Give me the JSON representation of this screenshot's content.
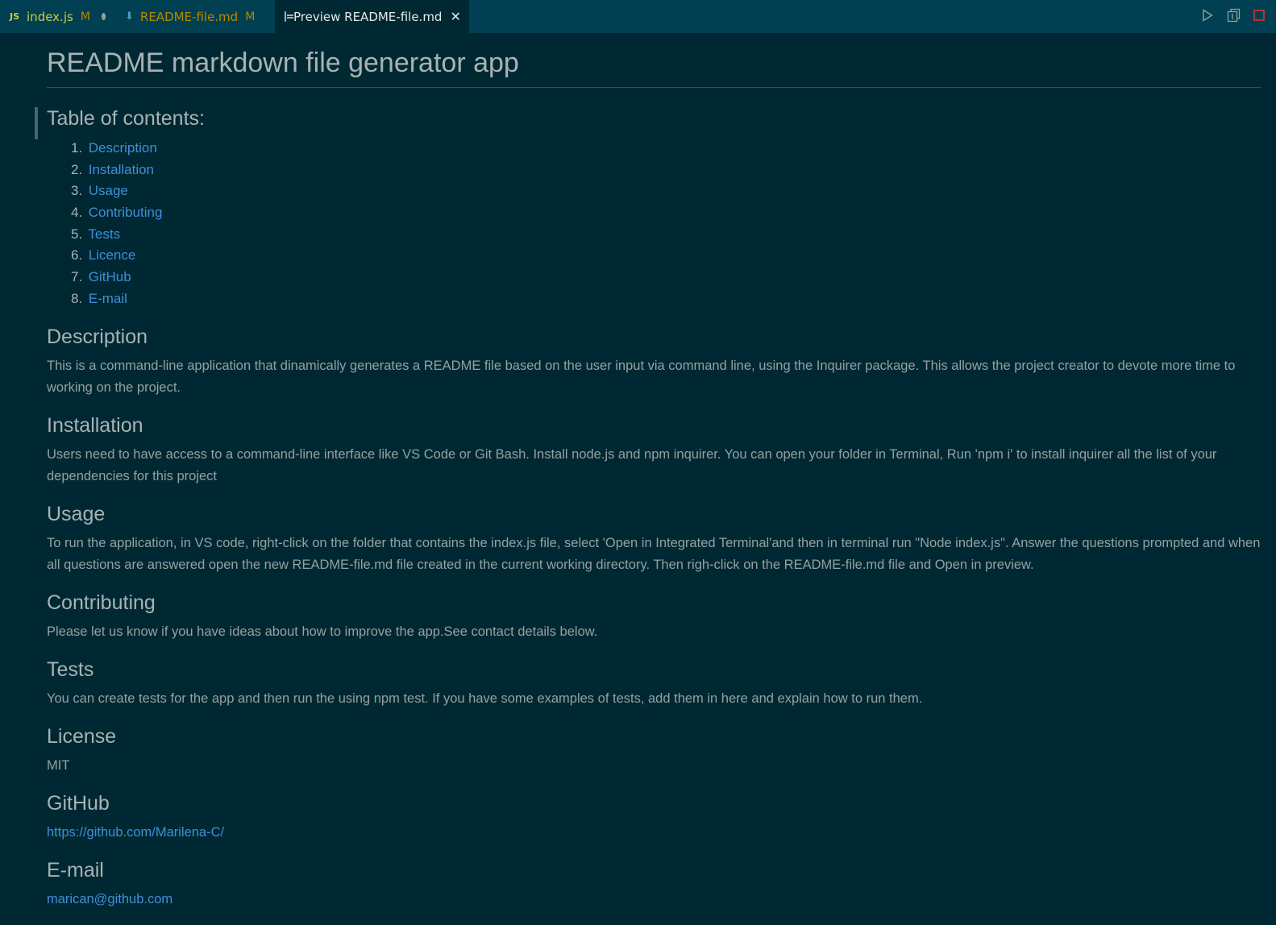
{
  "tabs": [
    {
      "badge": "JS",
      "label": "index.js",
      "status": "M"
    },
    {
      "label": "README-file.md",
      "status": "M"
    },
    {
      "label": "Preview README-file.md",
      "close": "✕"
    }
  ],
  "doc": {
    "title": "README markdown file generator app",
    "toc_heading": "Table of contents:",
    "toc": [
      {
        "num": "1.",
        "label": "Description"
      },
      {
        "num": "2.",
        "label": "Installation"
      },
      {
        "num": "3.",
        "label": "Usage"
      },
      {
        "num": "4.",
        "label": "Contributing"
      },
      {
        "num": "5.",
        "label": "Tests"
      },
      {
        "num": "6.",
        "label": "Licence"
      },
      {
        "num": "7.",
        "label": "GitHub"
      },
      {
        "num": "8.",
        "label": "E-mail"
      }
    ],
    "sections": {
      "description": {
        "heading": "Description",
        "body": "This is a command-line application that dinamically generates a README file based on the user input via command line, using the Inquirer package. This allows the project creator to devote more time to working on the project."
      },
      "installation": {
        "heading": "Installation",
        "body": "Users need to have access to a command-line interface like VS Code or Git Bash. Install node.js and npm inquirer. You can open your folder in Terminal, Run 'npm i' to install inquirer all the list of your dependencies for this project"
      },
      "usage": {
        "heading": "Usage",
        "body": "To run the application, in VS code, right-click on the folder that contains the index.js file, select 'Open in Integrated Terminal'and then in terminal run \"Node index.js\". Answer the questions prompted and when all questions are answered open the new README-file.md file created in the current working directory. Then righ-click on the README-file.md file and Open in preview."
      },
      "contributing": {
        "heading": "Contributing",
        "body": "Please let us know if you have ideas about how to improve the app.See contact details below."
      },
      "tests": {
        "heading": "Tests",
        "body": "You can create tests for the app and then run the using npm test. If you have some examples of tests, add them in here and explain how to run them."
      },
      "license": {
        "heading": "License",
        "body": "MIT"
      },
      "github": {
        "heading": "GitHub",
        "link": "https://github.com/Marilena-C/"
      },
      "email": {
        "heading": "E-mail",
        "link": "marican@github.com"
      }
    }
  },
  "icons": {
    "run": "play-icon",
    "split": "split-editor-icon",
    "stop": "stop-icon"
  },
  "colors": {
    "background": "#002833",
    "tabbar": "#004052",
    "link": "#3f8fd6",
    "modified": "#b58900"
  }
}
